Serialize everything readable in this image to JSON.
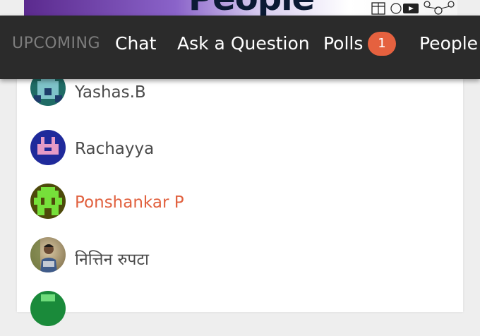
{
  "banner": {
    "title_text": "People"
  },
  "nav": {
    "tabs": [
      {
        "label": "UPCOMING"
      },
      {
        "label": "Chat"
      },
      {
        "label": "Ask a Question"
      },
      {
        "label": "Polls",
        "badge": "1"
      },
      {
        "label": "People"
      }
    ],
    "badge_color": "#e5613f"
  },
  "people": [
    {
      "name": "Yashas.B",
      "avatar": "pixel-avatar",
      "avatar_bg": "#1f6b65",
      "avatar_fg": "#7ec3c9"
    },
    {
      "name": "Rachayya",
      "avatar": "pixel-avatar",
      "avatar_bg": "#1f2a9b",
      "avatar_fg": "#e59ac6"
    },
    {
      "name": "Ponshankar P",
      "avatar": "pixel-avatar",
      "avatar_bg": "#4d4a0a",
      "avatar_fg": "#76e03a",
      "name_color": "#e1613f"
    },
    {
      "name": "नित्तिन रुपटा",
      "avatar": "photo-avatar"
    },
    {
      "name": "",
      "avatar": "pixel-avatar",
      "avatar_bg": "#1a8a3a",
      "avatar_fg": "#6fdc7b"
    }
  ]
}
